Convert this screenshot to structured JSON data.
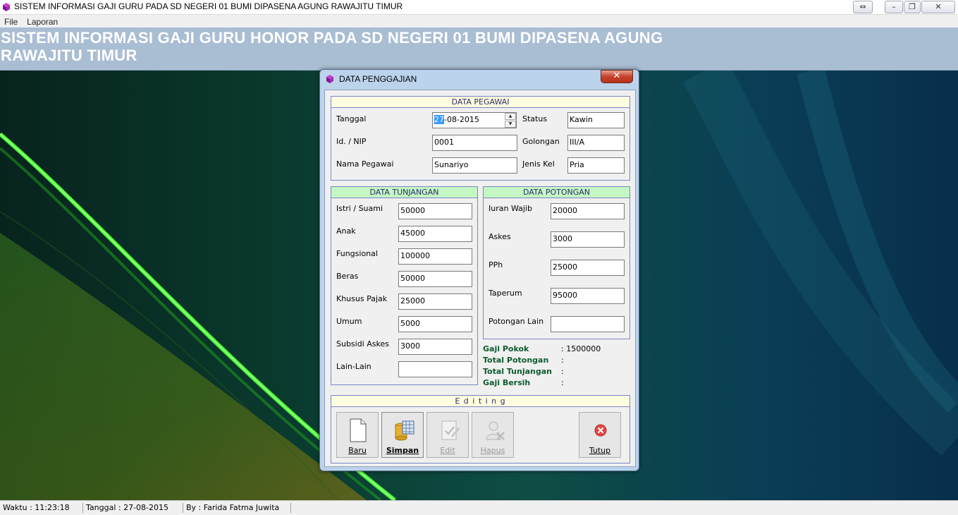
{
  "window": {
    "title": "SISTEM INFORMASI GAJI GURU PADA SD NEGERI 01 BUMI DIPASENA AGUNG RAWAJITU TIMUR",
    "close_label": "✕",
    "restore_label": "❐",
    "minimize_label": "–",
    "extra_label": "⇔"
  },
  "menu": {
    "items": [
      "File",
      "Laporan"
    ]
  },
  "banner": {
    "line1": "SISTEM INFORMASI GAJI GURU HONOR PADA SD NEGERI 01 BUMI DIPASENA AGUNG",
    "line2": "RAWAJITU TIMUR"
  },
  "dialog": {
    "title": "DATA PENGGAJIAN",
    "close_label": "✕",
    "pegawai": {
      "header": "DATA PEGAWAI",
      "tanggal_label": "Tanggal",
      "tanggal_value_sel": "27",
      "tanggal_value_rest": "-08-2015",
      "nip_label": "Id. / NIP",
      "nip_value": "0001",
      "nama_label": "Nama Pegawai",
      "nama_value": "Sunariyo",
      "status_label": "Status",
      "status_value": "Kawin",
      "golongan_label": "Golongan",
      "golongan_value": "III/A",
      "jenis_label": "Jenis Kel",
      "jenis_value": "Pria"
    },
    "tunjangan": {
      "header": "DATA TUNJANGAN",
      "rows": [
        {
          "label": "Istri / Suami",
          "value": "50000"
        },
        {
          "label": "Anak",
          "value": "45000"
        },
        {
          "label": "Fungsional",
          "value": "100000"
        },
        {
          "label": "Beras",
          "value": "50000"
        },
        {
          "label": "Khusus Pajak",
          "value": "25000"
        },
        {
          "label": "Umum",
          "value": "5000"
        },
        {
          "label": "Subsidi Askes",
          "value": "3000"
        },
        {
          "label": "Lain-Lain",
          "value": ""
        }
      ]
    },
    "potongan": {
      "header": "DATA POTONGAN",
      "rows": [
        {
          "label": "Iuran Wajib",
          "value": "20000"
        },
        {
          "label": "Askes",
          "value": "3000"
        },
        {
          "label": "PPh",
          "value": "25000"
        },
        {
          "label": "Taperum",
          "value": "95000"
        },
        {
          "label": "Potongan Lain",
          "value": ""
        }
      ]
    },
    "summary": {
      "gaji_pokok_label": "Gaji Pokok",
      "gaji_pokok_value": ": 1500000",
      "total_potongan_label": "Total Potongan",
      "total_potongan_value": ":",
      "total_tunjangan_label": "Total Tunjangan",
      "total_tunjangan_value": ":",
      "gaji_bersih_label": "Gaji Bersih",
      "gaji_bersih_value": ":"
    },
    "editing": {
      "header": "E d i t i n g",
      "baru": "Baru",
      "simpan": "Simpan",
      "edit": "Edit",
      "hapus": "Hapus",
      "tutup": "Tutup"
    }
  },
  "statusbar": {
    "waktu": "Waktu  :  11:23:18",
    "tanggal": "Tanggal  :  27-08-2015",
    "by": "By : Farida Fatma Juwita"
  },
  "colors": {
    "banner": "#a9bdd3",
    "group_border": "#7a86c2",
    "header_pegawai": "#fffde0",
    "header_tunjangan": "#c4f7c4",
    "summary_text": "#0e5a2f",
    "dialog_frame": "#bcd3ec"
  }
}
